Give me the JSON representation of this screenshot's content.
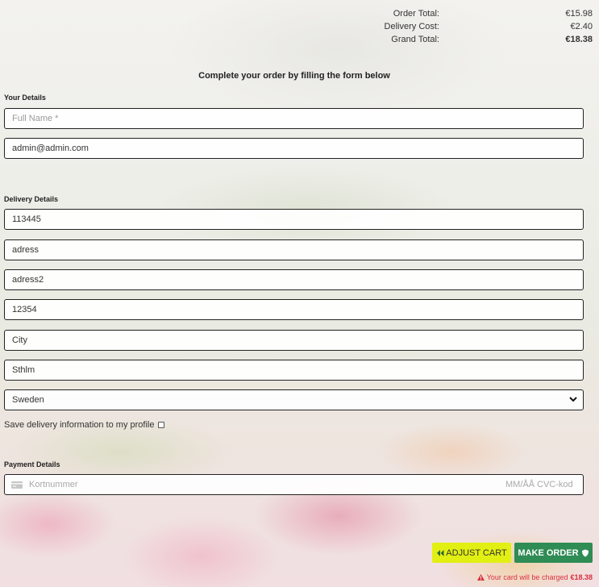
{
  "totals": {
    "order_total_label": "Order Total:",
    "order_total_value": "€15.98",
    "delivery_cost_label": "Delivery Cost:",
    "delivery_cost_value": "€2.40",
    "grand_total_label": "Grand Total:",
    "grand_total_value": "€18.38"
  },
  "intro_text": "Complete your order by filling the form below",
  "your_details": {
    "legend": "Your Details",
    "full_name_placeholder": "Full Name *",
    "email_value": "admin@admin.com"
  },
  "delivery_details": {
    "legend": "Delivery Details",
    "phone_value": "113445",
    "street1_value": "adress",
    "street2_value": "adress2",
    "postcode_value": "12354",
    "city_value": "City",
    "county_value": "Sthlm",
    "country_value": "Sweden",
    "save_info_label": "Save delivery information to my profile"
  },
  "payment": {
    "legend": "Payment Details",
    "card_number_placeholder": "Kortnummer",
    "expiry_placeholder": "MM/ÅÅ",
    "cvc_placeholder": "CVC-kod"
  },
  "buttons": {
    "adjust_cart_label": "ADJUST CART",
    "make_order_label": "MAKE ORDER"
  },
  "charge_notice": {
    "text": "Your card will be charged",
    "amount": "€18.38"
  },
  "colors": {
    "adjust_button": "#e2ef12",
    "order_button": "#2f8c55",
    "warning_text": "#d9303e"
  },
  "icons": {
    "adjust": "double-chevron-left-icon",
    "order": "shield-icon",
    "warning": "warning-triangle-icon",
    "card": "credit-card-icon",
    "select": "chevron-down-icon"
  }
}
